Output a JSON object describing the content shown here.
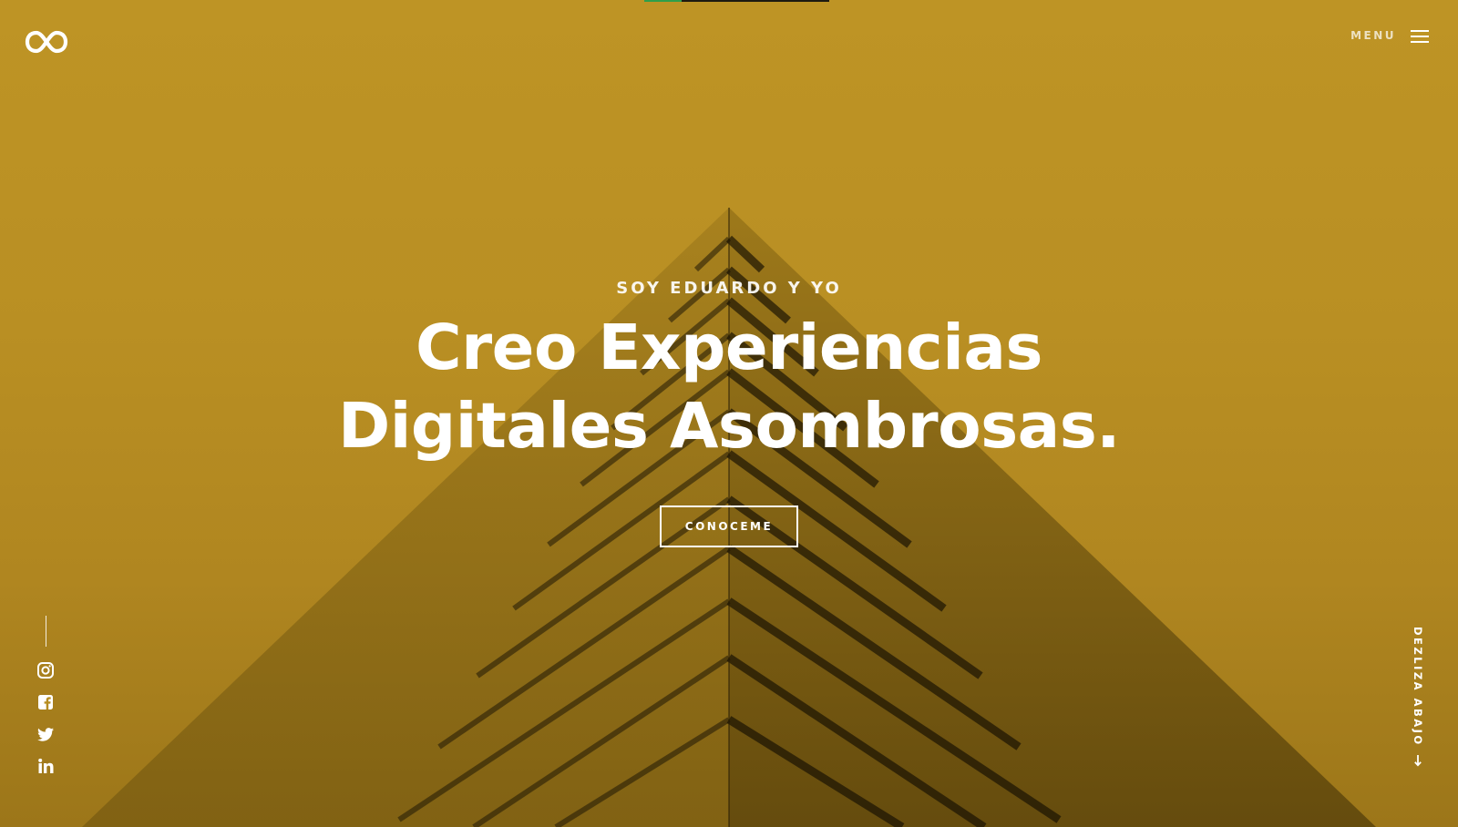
{
  "header": {
    "logo_icon": "infinity-icon",
    "menu_label": "MENU",
    "menu_icon": "hamburger-icon"
  },
  "hero": {
    "eyebrow": "SOY EDUARDO Y YO",
    "headline_line1": "Creo Experiencias",
    "headline_line2": "Digitales Asombrosas.",
    "cta_label": "CONOCEME",
    "overlay_color": "#b68d22"
  },
  "social": {
    "items": [
      {
        "icon": "instagram-icon"
      },
      {
        "icon": "facebook-icon"
      },
      {
        "icon": "twitter-icon"
      },
      {
        "icon": "linkedin-icon"
      }
    ]
  },
  "scroll": {
    "label": "DEZLIZA ABAJO",
    "icon": "arrow-down-icon"
  },
  "loader": {
    "progress": 0.2,
    "fill_color": "#2f9f4a"
  }
}
